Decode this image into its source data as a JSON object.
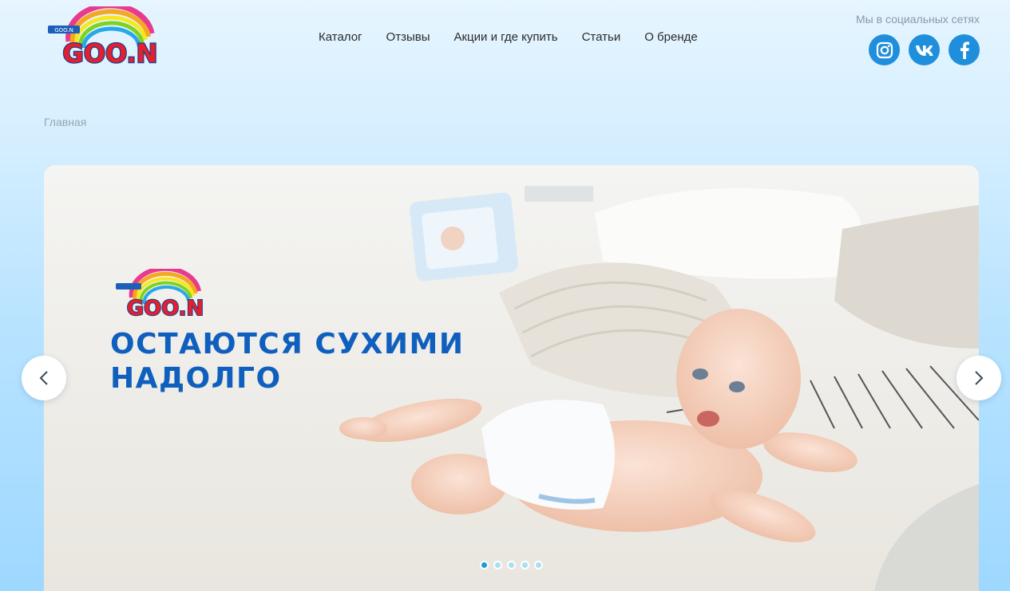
{
  "header": {
    "logo": {
      "text": "GOO.N",
      "icon": "goon-logo"
    },
    "nav": [
      {
        "label": "Каталог"
      },
      {
        "label": "Отзывы"
      },
      {
        "label": "Акции и где купить"
      },
      {
        "label": "Статьи"
      },
      {
        "label": "О бренде"
      }
    ],
    "social": {
      "title": "Мы в социальных сетях",
      "links": [
        {
          "icon": "instagram-icon"
        },
        {
          "icon": "vk-icon"
        },
        {
          "icon": "facebook-icon"
        }
      ],
      "color": "#1f8fdc"
    }
  },
  "breadcrumb": {
    "home": "Главная"
  },
  "slider": {
    "headline": "ОСТАЮТСЯ СУХИМИ\nНАДОЛГО",
    "headline_color": "#0f5fbe",
    "slide_count": 5,
    "active_slide": 1,
    "prev_icon": "chevron-left-icon",
    "next_icon": "chevron-right-icon"
  },
  "colors": {
    "accent": "#1f8fdc",
    "dot_active": "#1a9ed2",
    "dot_inactive": "#a9dff1"
  }
}
